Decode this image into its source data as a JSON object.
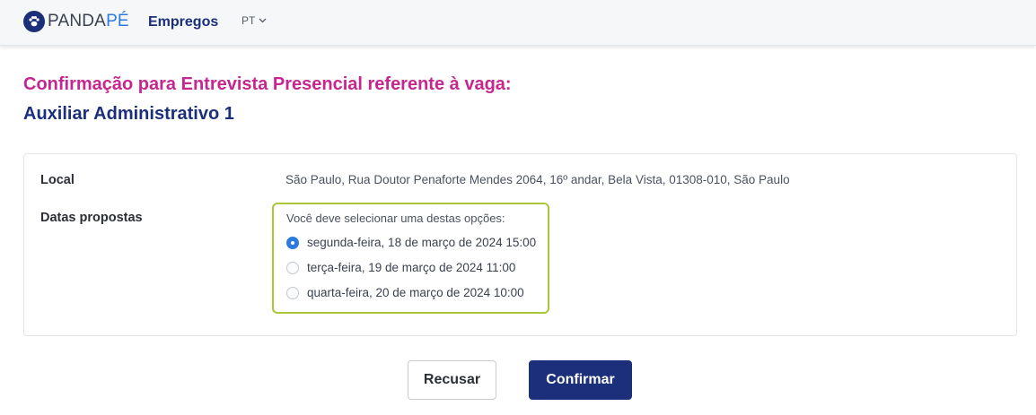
{
  "header": {
    "logo": {
      "part1": "PANDA",
      "part2": "PÉ",
      "icon": "paw-icon"
    },
    "nav_label": "Empregos",
    "lang": {
      "label": "PT",
      "icon": "chevron-down-icon"
    }
  },
  "page": {
    "title": "Confirmação para Entrevista Presencial referente à vaga:",
    "job_title": "Auxiliar Administrativo 1"
  },
  "details": {
    "local_label": "Local",
    "address": "São Paulo, Rua Doutor Penaforte Mendes 2064, 16º andar, Bela Vista, 01308-010, São Paulo",
    "dates_label": "Datas propostas",
    "dates_hint": "Você deve selecionar uma destas opções:",
    "options": [
      {
        "label": "segunda-feira, 18 de março de 2024 15:00",
        "selected": true
      },
      {
        "label": "terça-feira, 19 de março de 2024 11:00",
        "selected": false
      },
      {
        "label": "quarta-feira, 20 de março de 2024 10:00",
        "selected": false
      }
    ]
  },
  "actions": {
    "refuse_label": "Recusar",
    "confirm_label": "Confirmar"
  },
  "colors": {
    "brand_navy": "#1b2f7a",
    "title_magenta": "#c6268f",
    "accent_blue": "#2b7be0",
    "highlight_green": "#a8c83a"
  }
}
